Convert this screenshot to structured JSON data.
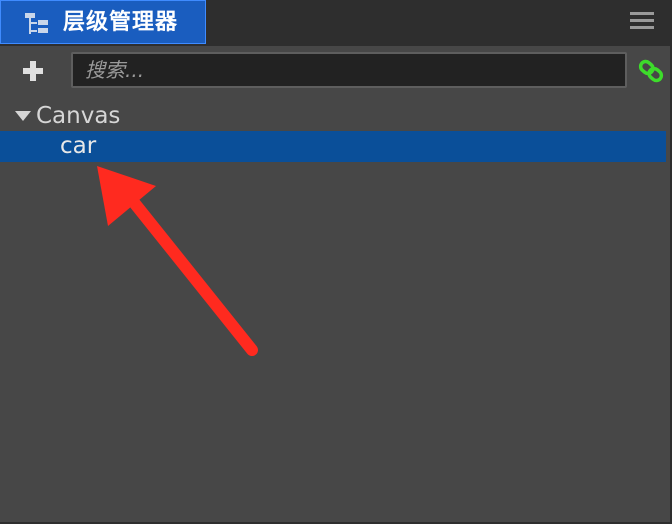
{
  "panel": {
    "title": "层级管理器",
    "icon": "hierarchy-icon",
    "menu_icon": "hamburger-menu-icon"
  },
  "toolbar": {
    "add_icon": "plus-icon",
    "search_placeholder": "搜索...",
    "search_value": "",
    "link_icon": "link-icon"
  },
  "tree": {
    "nodes": [
      {
        "label": "Canvas",
        "expanded": true,
        "selected": false
      },
      {
        "label": "car",
        "selected": true
      }
    ]
  },
  "colors": {
    "tab_active": "#1a5dbf",
    "selection": "#0a4f99",
    "link_icon": "#3ddc2b",
    "annotation_arrow": "#ff2a1f",
    "panel_bg": "#474747"
  }
}
